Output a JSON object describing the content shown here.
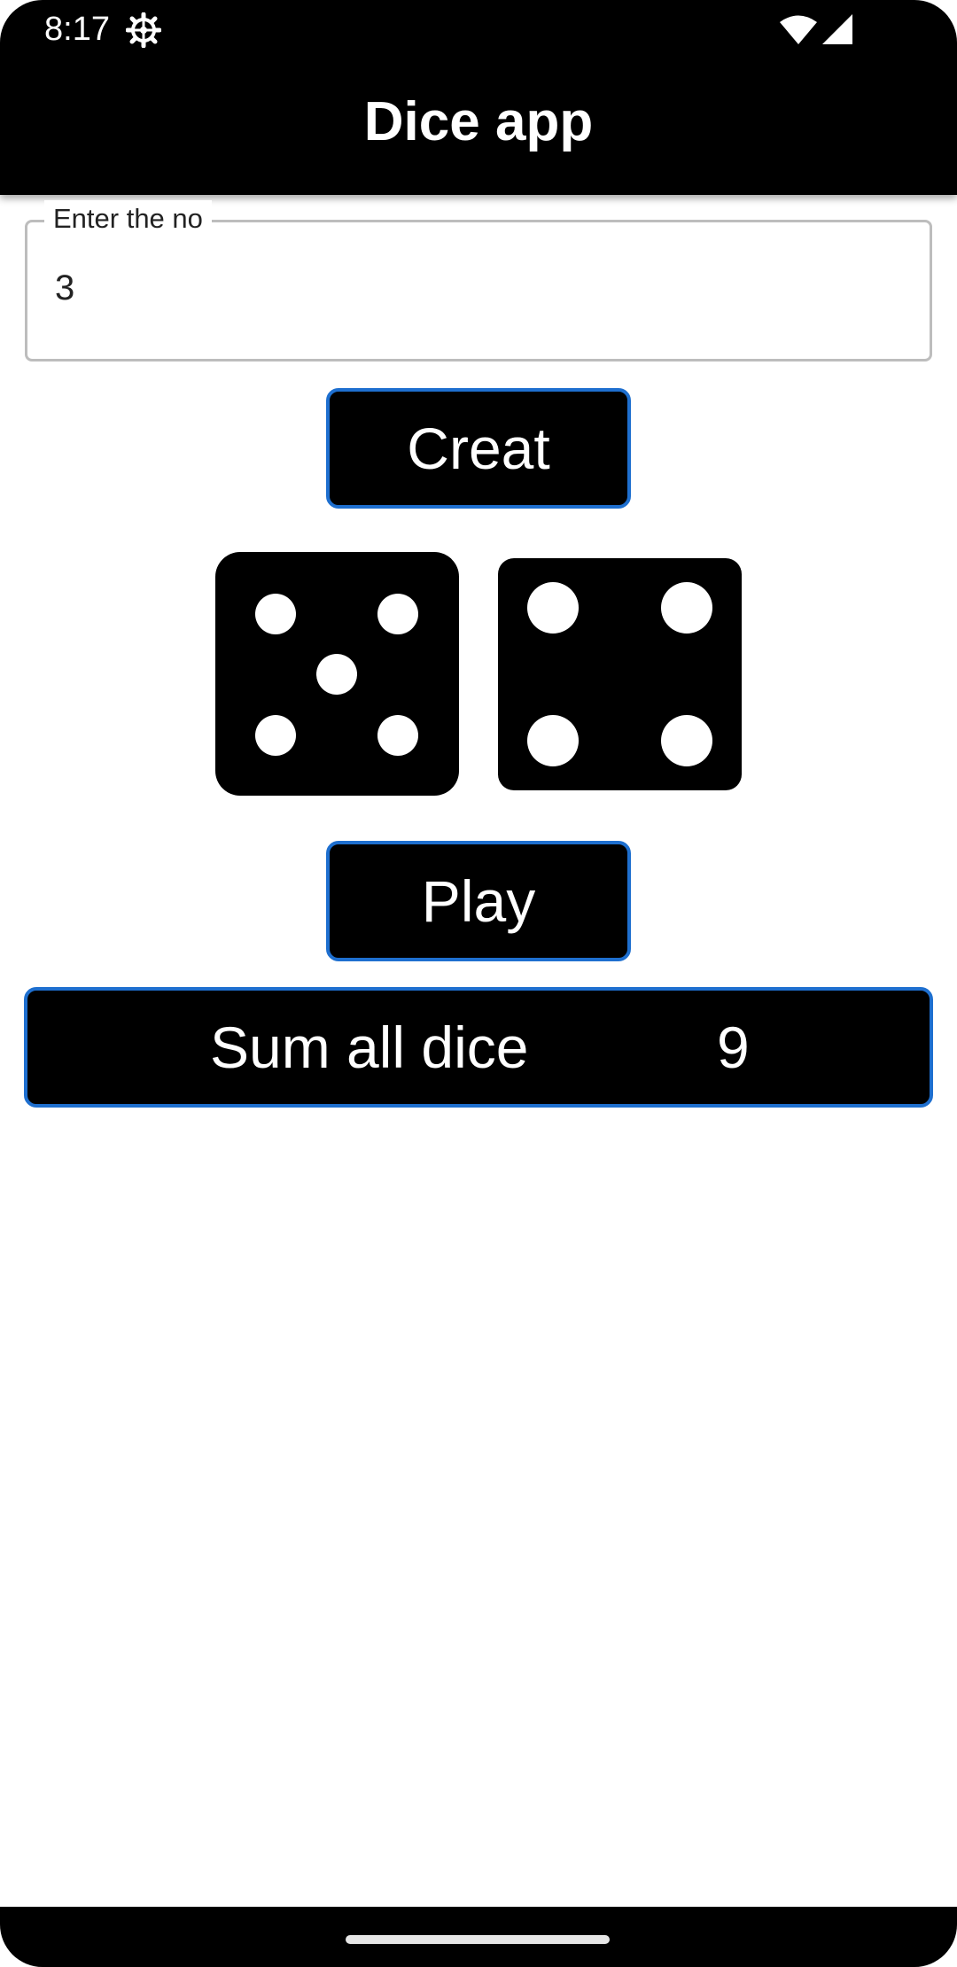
{
  "status_bar": {
    "time": "8:17",
    "icons": [
      "settings-icon",
      "wifi-icon",
      "cell-signal-icon"
    ]
  },
  "app_bar": {
    "title": "Dice app"
  },
  "number_input": {
    "label": "Enter the no",
    "value": "3"
  },
  "create_button": {
    "label": "Creat"
  },
  "dice": [
    {
      "face": 5
    },
    {
      "face": 4
    }
  ],
  "play_button": {
    "label": "Play"
  },
  "sum_bar": {
    "label": "Sum all dice",
    "value": "9"
  },
  "colors": {
    "accent": "#1e6fcf",
    "surface": "#000000",
    "background": "#ffffff",
    "text_on_dark": "#ffffff"
  }
}
